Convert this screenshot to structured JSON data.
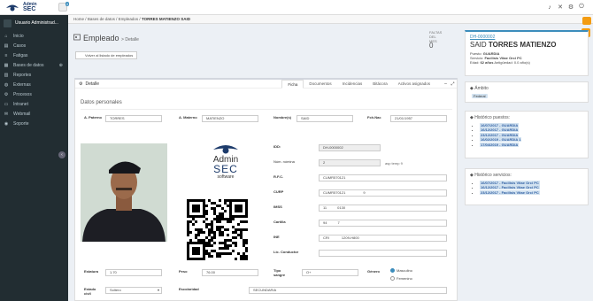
{
  "app": {
    "brand_top": "Admin",
    "brand": "SEC",
    "notif_count": "4"
  },
  "sidebar": {
    "user": "Usuario Administrad...",
    "items": [
      {
        "label": "Inicio",
        "icon": "home-icon",
        "glyph": "⌂"
      },
      {
        "label": "Casos",
        "icon": "folder-icon",
        "glyph": "▤"
      },
      {
        "label": "Fatigas",
        "icon": "list-icon",
        "glyph": "≡"
      },
      {
        "label": "Bases de datos",
        "icon": "database-icon",
        "glyph": "▦",
        "exp": "⊕"
      },
      {
        "label": "Reportes",
        "icon": "chart-icon",
        "glyph": "▥"
      },
      {
        "label": "Externas",
        "icon": "globe-icon",
        "glyph": "◍"
      },
      {
        "label": "Procesos",
        "icon": "cog-icon",
        "glyph": "⚙"
      },
      {
        "label": "Intranet",
        "icon": "monitor-icon",
        "glyph": "▭"
      },
      {
        "label": "Webmail",
        "icon": "mail-icon",
        "glyph": "✉"
      },
      {
        "label": "Soporte",
        "icon": "support-icon",
        "glyph": "◉"
      }
    ]
  },
  "breadcrumb": {
    "home": "Home",
    "sep1": "/",
    "l1": "Bases de datos",
    "sep2": "/",
    "l2": "Empleados",
    "sep3": "/",
    "current": "TORRES MATIENZO SAID"
  },
  "header": {
    "title": "Empleado",
    "subtitle": "> Detalle",
    "return_btn": "Volver al listado de empleados",
    "faltas_label": "FALTAS",
    "faltas_sub": "DEL MES",
    "faltas_value": "0"
  },
  "panel": {
    "title": "Detalle",
    "tabs": [
      "Ficha",
      "Documentos",
      "Incidencias",
      "Bitácora",
      "Activos asignados"
    ],
    "section": "Datos personales",
    "labels": {
      "paterno": "A. Paterno",
      "materno": "A. Materno",
      "nombre": "Nombre(s)",
      "fnac": "Fch.Nac",
      "id": "IDD:",
      "nomina": "Núm. nómina",
      "rfc": "R.F.C.",
      "curp": "CURP",
      "imss": "IMSS",
      "cartilla": "Cartilla",
      "ine": "INE",
      "licencia": "Lic. Conductor",
      "estatura": "Estatura",
      "peso": "Peso",
      "tipo": "Tipo sangre",
      "genero": "Género",
      "edocivil": "Estado civil",
      "escolaridad": "Escolaridad"
    },
    "values": {
      "paterno": "TORRES",
      "materno": "MATIENZO",
      "nombre": "SAID",
      "fnac": "21/01/1957",
      "id": "DH-0000002",
      "nomina": "2",
      "nomina_hint": "asp temp 9",
      "rfc": "CUMR570121",
      "curp": "CUMR570121",
      "curp_tail": "9",
      "imss": "11",
      "imss_tail": "0130",
      "cartilla": "94",
      "cartilla_tail": "7",
      "ine": "CRI",
      "ine_tail": "1209-H800",
      "licencia": "",
      "estatura": "1.70",
      "peso": "76.00",
      "tipo": "O+",
      "genero_m": "Masculino",
      "genero_f": "Femenino",
      "edocivil": "Soltero",
      "escolaridad": "SECUNDARIA"
    },
    "card_logo": {
      "a": "Admin",
      "s": "SEC",
      "w": "software"
    }
  },
  "idcard": {
    "code": "DH-0000002",
    "first": "SAID",
    "last": "TORRES MATIENZO",
    "puesto_l": "Puesto:",
    "puesto": "GUARDIA",
    "servicio_l": "Servicio:",
    "servicio": "Facilisis Vitae Orci PC",
    "edad_l": "Edad:",
    "edad": "62 años",
    "antig": "Antigüedad: 0.0 año(s)"
  },
  "ambito": {
    "title": "Ámbito",
    "tag": "Federal"
  },
  "historico_puestos": {
    "title": "Histórico puestos:",
    "items": [
      "16/07/2017 - GUARDIA",
      "16/12/2017 - GUARDIA",
      "23/12/2017 - GUARDIA",
      "16/02/2019 - GUARDIA 1",
      "17/04/2019 - GUARDIA"
    ]
  },
  "historico_servicios": {
    "title": "Histórico servicios:",
    "items": [
      "16/07/2017 - Facilisis Vitae Orci PC",
      "16/12/2017 - Facilisis Vitae Orci PC",
      "23/12/2017 - Facilisis Vitae Orci PC"
    ]
  },
  "colors": {
    "accent": "#3c8dbc",
    "sidebar": "#222d32",
    "warning": "#f39c12"
  }
}
